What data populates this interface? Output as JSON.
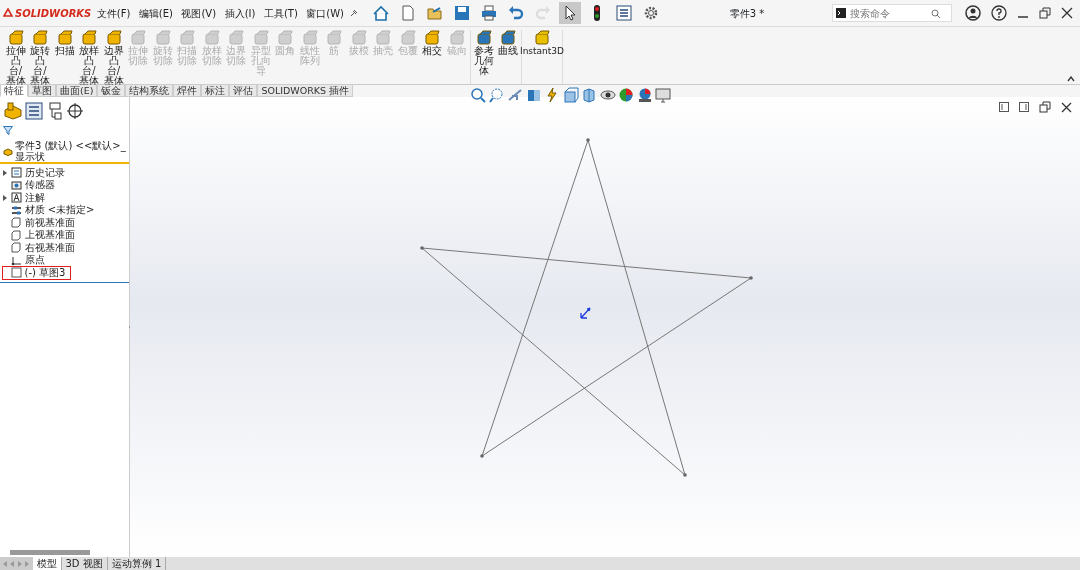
{
  "window": {
    "title": "零件3 *"
  },
  "logo": "SOLIDWORKS",
  "menu": [
    "文件(F)",
    "编辑(E)",
    "视图(V)",
    "插入(I)",
    "工具(T)",
    "窗口(W)"
  ],
  "toolbar": [
    {
      "kind": "home",
      "selected": false,
      "disabled": false
    },
    {
      "kind": "new",
      "selected": false,
      "disabled": false
    },
    {
      "kind": "open",
      "selected": false,
      "disabled": false
    },
    {
      "kind": "save",
      "selected": false,
      "disabled": false
    },
    {
      "kind": "print",
      "selected": false,
      "disabled": false
    },
    {
      "kind": "undo",
      "selected": false,
      "disabled": false
    },
    {
      "kind": "redo",
      "selected": false,
      "disabled": true
    },
    {
      "kind": "select",
      "selected": true,
      "disabled": false
    },
    {
      "kind": "rebuild",
      "selected": false,
      "disabled": false
    },
    {
      "kind": "options_list",
      "selected": false,
      "disabled": false
    },
    {
      "kind": "settings",
      "selected": false,
      "disabled": false
    }
  ],
  "search": {
    "placeholder": "搜索命令"
  },
  "ribbon": [
    {
      "buttons": [
        {
          "label": "拉伸凸台/基体",
          "disabled": false
        },
        {
          "label": "旋转凸台/基体",
          "disabled": false
        },
        {
          "label": "扫描",
          "disabled": false
        },
        {
          "label": "放样凸台/基体",
          "disabled": false
        },
        {
          "label": "边界凸台/基体",
          "disabled": false
        },
        {
          "label": "拉伸切除",
          "disabled": true
        },
        {
          "label": "旋转切除",
          "disabled": true
        },
        {
          "label": "扫描切除",
          "disabled": true
        },
        {
          "label": "放样切除",
          "disabled": true
        },
        {
          "label": "边界切除",
          "disabled": true
        },
        {
          "label": "异型孔向导",
          "disabled": true
        },
        {
          "label": "圆角",
          "disabled": true
        },
        {
          "label": "线性阵列",
          "disabled": true
        },
        {
          "label": "筋",
          "disabled": true
        },
        {
          "label": "拔模",
          "disabled": true
        },
        {
          "label": "抽壳",
          "disabled": true
        },
        {
          "label": "包覆",
          "disabled": true
        },
        {
          "label": "相交",
          "disabled": false
        },
        {
          "label": "镜向",
          "disabled": true
        }
      ]
    },
    {
      "buttons": [
        {
          "label": "参考几何体",
          "disabled": false
        },
        {
          "label": "曲线",
          "disabled": false
        }
      ]
    },
    {
      "buttons": [
        {
          "label": "Instant3D",
          "disabled": false
        }
      ]
    }
  ],
  "command_tabs": [
    {
      "label": "特征",
      "selected": true
    },
    {
      "label": "草图",
      "selected": false
    },
    {
      "label": "曲面(E)",
      "selected": false
    },
    {
      "label": "钣金",
      "selected": false
    },
    {
      "label": "结构系统",
      "selected": false
    },
    {
      "label": "焊件",
      "selected": false
    },
    {
      "label": "标注",
      "selected": false
    },
    {
      "label": "评估",
      "selected": false
    },
    {
      "label": "SOLIDWORKS 插件",
      "selected": false
    }
  ],
  "tree": {
    "root": "零件3 (默认) <<默认>_显示状",
    "items": [
      {
        "label": "历史记录",
        "kind": "history",
        "collapsible": true,
        "selected": false
      },
      {
        "label": "传感器",
        "kind": "sensor",
        "collapsible": false,
        "selected": false
      },
      {
        "label": "注解",
        "kind": "annotation",
        "collapsible": true,
        "selected": false
      },
      {
        "label": "材质 <未指定>",
        "kind": "material",
        "collapsible": false,
        "selected": false
      },
      {
        "label": "前视基准面",
        "kind": "plane",
        "collapsible": false,
        "selected": false
      },
      {
        "label": "上视基准面",
        "kind": "plane",
        "collapsible": false,
        "selected": false
      },
      {
        "label": "右视基准面",
        "kind": "plane",
        "collapsible": false,
        "selected": false
      },
      {
        "label": "原点",
        "kind": "origin",
        "collapsible": false,
        "selected": false
      },
      {
        "label": "(-) 草图3",
        "kind": "sketch",
        "collapsible": false,
        "selected": true
      }
    ]
  },
  "bottom_tabs": [
    {
      "label": "模型",
      "selected": true
    },
    {
      "label": "3D 视图",
      "selected": false
    },
    {
      "label": "运动算例 1",
      "selected": false
    }
  ]
}
